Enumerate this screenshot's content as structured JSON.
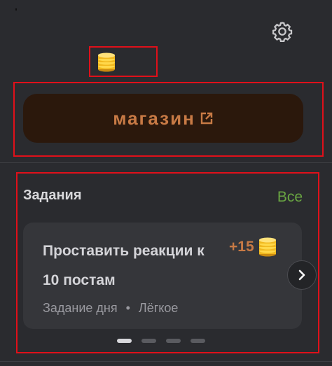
{
  "header": {
    "settings_icon": "gear-icon"
  },
  "balance": {
    "icon": "coin-stack-icon",
    "amount": ""
  },
  "shop": {
    "label": "магазин",
    "icon": "external-link-icon",
    "color": "#c87a45",
    "background": "#2b180c"
  },
  "tasks": {
    "title": "Задания",
    "all_label": "Все",
    "all_color": "#69a542",
    "cards": [
      {
        "title": "Проставить реакции к 10 постам",
        "reward": "+15",
        "reward_icon": "coin-stack-icon",
        "type": "Задание дня",
        "separator": "•",
        "difficulty": "Лёгкое"
      }
    ],
    "next_icon": "chevron-right-icon",
    "pager": {
      "count": 4,
      "active": 1
    }
  }
}
